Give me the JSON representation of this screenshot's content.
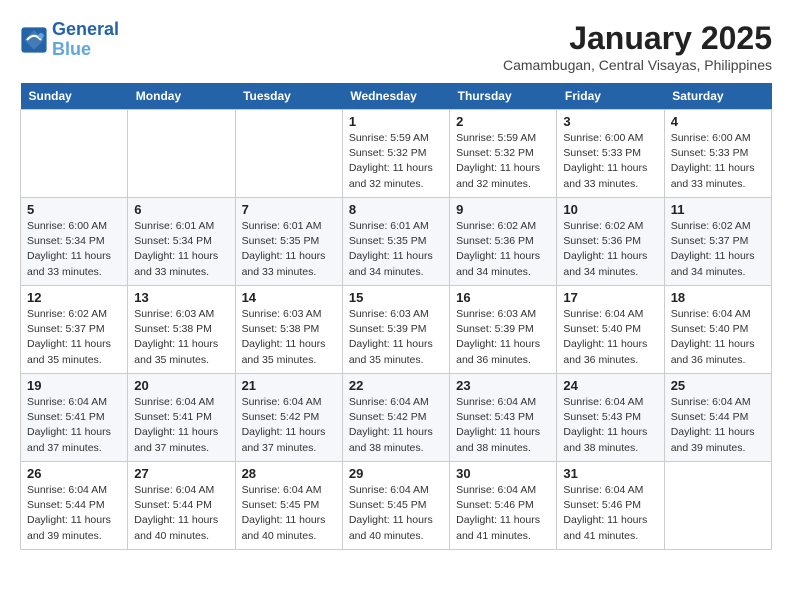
{
  "header": {
    "logo_line1": "General",
    "logo_line2": "Blue",
    "month": "January 2025",
    "location": "Camambugan, Central Visayas, Philippines"
  },
  "weekdays": [
    "Sunday",
    "Monday",
    "Tuesday",
    "Wednesday",
    "Thursday",
    "Friday",
    "Saturday"
  ],
  "weeks": [
    [
      {
        "day": "",
        "info": ""
      },
      {
        "day": "",
        "info": ""
      },
      {
        "day": "",
        "info": ""
      },
      {
        "day": "1",
        "info": "Sunrise: 5:59 AM\nSunset: 5:32 PM\nDaylight: 11 hours\nand 32 minutes."
      },
      {
        "day": "2",
        "info": "Sunrise: 5:59 AM\nSunset: 5:32 PM\nDaylight: 11 hours\nand 32 minutes."
      },
      {
        "day": "3",
        "info": "Sunrise: 6:00 AM\nSunset: 5:33 PM\nDaylight: 11 hours\nand 33 minutes."
      },
      {
        "day": "4",
        "info": "Sunrise: 6:00 AM\nSunset: 5:33 PM\nDaylight: 11 hours\nand 33 minutes."
      }
    ],
    [
      {
        "day": "5",
        "info": "Sunrise: 6:00 AM\nSunset: 5:34 PM\nDaylight: 11 hours\nand 33 minutes."
      },
      {
        "day": "6",
        "info": "Sunrise: 6:01 AM\nSunset: 5:34 PM\nDaylight: 11 hours\nand 33 minutes."
      },
      {
        "day": "7",
        "info": "Sunrise: 6:01 AM\nSunset: 5:35 PM\nDaylight: 11 hours\nand 33 minutes."
      },
      {
        "day": "8",
        "info": "Sunrise: 6:01 AM\nSunset: 5:35 PM\nDaylight: 11 hours\nand 34 minutes."
      },
      {
        "day": "9",
        "info": "Sunrise: 6:02 AM\nSunset: 5:36 PM\nDaylight: 11 hours\nand 34 minutes."
      },
      {
        "day": "10",
        "info": "Sunrise: 6:02 AM\nSunset: 5:36 PM\nDaylight: 11 hours\nand 34 minutes."
      },
      {
        "day": "11",
        "info": "Sunrise: 6:02 AM\nSunset: 5:37 PM\nDaylight: 11 hours\nand 34 minutes."
      }
    ],
    [
      {
        "day": "12",
        "info": "Sunrise: 6:02 AM\nSunset: 5:37 PM\nDaylight: 11 hours\nand 35 minutes."
      },
      {
        "day": "13",
        "info": "Sunrise: 6:03 AM\nSunset: 5:38 PM\nDaylight: 11 hours\nand 35 minutes."
      },
      {
        "day": "14",
        "info": "Sunrise: 6:03 AM\nSunset: 5:38 PM\nDaylight: 11 hours\nand 35 minutes."
      },
      {
        "day": "15",
        "info": "Sunrise: 6:03 AM\nSunset: 5:39 PM\nDaylight: 11 hours\nand 35 minutes."
      },
      {
        "day": "16",
        "info": "Sunrise: 6:03 AM\nSunset: 5:39 PM\nDaylight: 11 hours\nand 36 minutes."
      },
      {
        "day": "17",
        "info": "Sunrise: 6:04 AM\nSunset: 5:40 PM\nDaylight: 11 hours\nand 36 minutes."
      },
      {
        "day": "18",
        "info": "Sunrise: 6:04 AM\nSunset: 5:40 PM\nDaylight: 11 hours\nand 36 minutes."
      }
    ],
    [
      {
        "day": "19",
        "info": "Sunrise: 6:04 AM\nSunset: 5:41 PM\nDaylight: 11 hours\nand 37 minutes."
      },
      {
        "day": "20",
        "info": "Sunrise: 6:04 AM\nSunset: 5:41 PM\nDaylight: 11 hours\nand 37 minutes."
      },
      {
        "day": "21",
        "info": "Sunrise: 6:04 AM\nSunset: 5:42 PM\nDaylight: 11 hours\nand 37 minutes."
      },
      {
        "day": "22",
        "info": "Sunrise: 6:04 AM\nSunset: 5:42 PM\nDaylight: 11 hours\nand 38 minutes."
      },
      {
        "day": "23",
        "info": "Sunrise: 6:04 AM\nSunset: 5:43 PM\nDaylight: 11 hours\nand 38 minutes."
      },
      {
        "day": "24",
        "info": "Sunrise: 6:04 AM\nSunset: 5:43 PM\nDaylight: 11 hours\nand 38 minutes."
      },
      {
        "day": "25",
        "info": "Sunrise: 6:04 AM\nSunset: 5:44 PM\nDaylight: 11 hours\nand 39 minutes."
      }
    ],
    [
      {
        "day": "26",
        "info": "Sunrise: 6:04 AM\nSunset: 5:44 PM\nDaylight: 11 hours\nand 39 minutes."
      },
      {
        "day": "27",
        "info": "Sunrise: 6:04 AM\nSunset: 5:44 PM\nDaylight: 11 hours\nand 40 minutes."
      },
      {
        "day": "28",
        "info": "Sunrise: 6:04 AM\nSunset: 5:45 PM\nDaylight: 11 hours\nand 40 minutes."
      },
      {
        "day": "29",
        "info": "Sunrise: 6:04 AM\nSunset: 5:45 PM\nDaylight: 11 hours\nand 40 minutes."
      },
      {
        "day": "30",
        "info": "Sunrise: 6:04 AM\nSunset: 5:46 PM\nDaylight: 11 hours\nand 41 minutes."
      },
      {
        "day": "31",
        "info": "Sunrise: 6:04 AM\nSunset: 5:46 PM\nDaylight: 11 hours\nand 41 minutes."
      },
      {
        "day": "",
        "info": ""
      }
    ]
  ]
}
